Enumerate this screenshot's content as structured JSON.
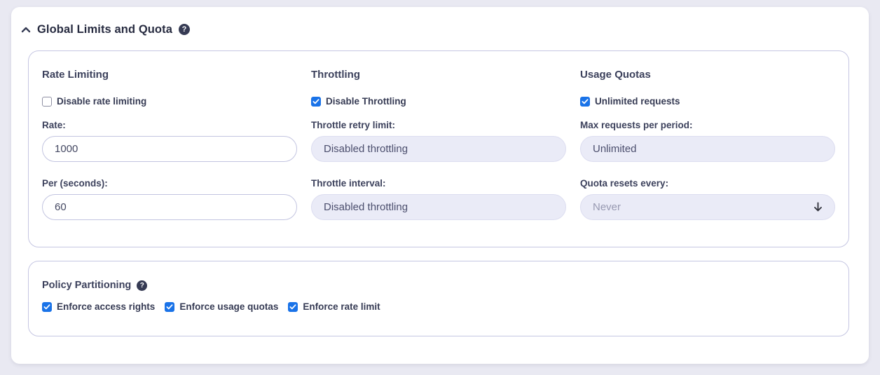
{
  "accordion": {
    "title": "Global Limits and Quota"
  },
  "glyphs": {
    "question": "?"
  },
  "limits_panel": {
    "columns": [
      {
        "heading": "Rate Limiting",
        "checkbox": {
          "label": "Disable rate limiting",
          "checked": false
        },
        "fields": [
          {
            "label": "Rate:",
            "value": "1000",
            "disabled": false,
            "control": "text"
          },
          {
            "label": "Per (seconds):",
            "value": "60",
            "disabled": false,
            "control": "text"
          }
        ]
      },
      {
        "heading": "Throttling",
        "checkbox": {
          "label": "Disable Throttling",
          "checked": true
        },
        "fields": [
          {
            "label": "Throttle retry limit:",
            "value": "Disabled throttling",
            "disabled": true,
            "control": "text"
          },
          {
            "label": "Throttle interval:",
            "value": "Disabled throttling",
            "disabled": true,
            "control": "text"
          }
        ]
      },
      {
        "heading": "Usage Quotas",
        "checkbox": {
          "label": "Unlimited requests",
          "checked": true
        },
        "fields": [
          {
            "label": "Max requests per period:",
            "value": "Unlimited",
            "disabled": true,
            "control": "text"
          },
          {
            "label": "Quota resets every:",
            "value": "Never",
            "disabled": true,
            "control": "select"
          }
        ]
      }
    ]
  },
  "partitioning_panel": {
    "heading": "Policy Partitioning",
    "checkboxes": [
      {
        "label": "Enforce access rights",
        "checked": true
      },
      {
        "label": "Enforce usage quotas",
        "checked": true
      },
      {
        "label": "Enforce rate limit",
        "checked": true
      }
    ]
  },
  "colors": {
    "accent_checkbox": "#1a73e8",
    "panel_border": "#c5c6e2",
    "disabled_field_bg": "#eaebf7",
    "heading_text": "#3c415c",
    "page_background": "#e9e9f2",
    "icon_dark": "#363b54"
  }
}
